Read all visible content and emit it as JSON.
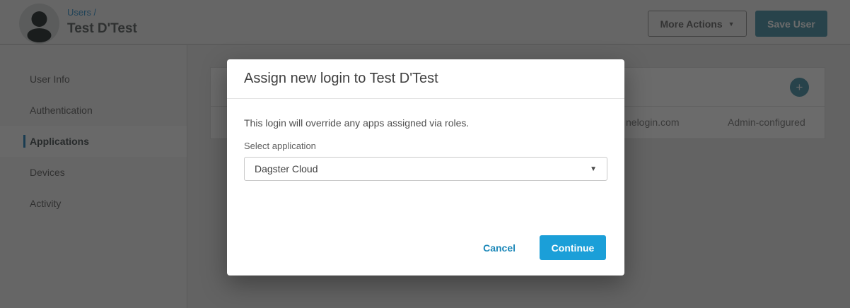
{
  "header": {
    "breadcrumb": "Users /",
    "title": "Test D'Test",
    "more_actions_label": "More Actions",
    "save_user_label": "Save User"
  },
  "sidebar": {
    "items": [
      {
        "label": "User Info",
        "active": false
      },
      {
        "label": "Authentication",
        "active": false
      },
      {
        "label": "Applications",
        "active": true
      },
      {
        "label": "Devices",
        "active": false
      },
      {
        "label": "Activity",
        "active": false
      }
    ]
  },
  "background_panel": {
    "add_button_icon": "+",
    "row": {
      "login_url_fragment": "nelogin.com",
      "config_type": "Admin-configured"
    }
  },
  "modal": {
    "title": "Assign new login to Test D'Test",
    "body_text": "This login will override any apps assigned via roles.",
    "select_label": "Select application",
    "select_value": "Dagster Cloud",
    "cancel_label": "Cancel",
    "continue_label": "Continue"
  },
  "icons": {
    "chevron_down": "▼",
    "plus": "+"
  },
  "colors": {
    "teal_button": "#5f9fb2",
    "continue_blue": "#1b9fd8",
    "cancel_link_blue": "#1b87b8",
    "breadcrumb_link_blue": "#4d9fd1",
    "active_nav_bar_blue": "#3e8fc0"
  }
}
